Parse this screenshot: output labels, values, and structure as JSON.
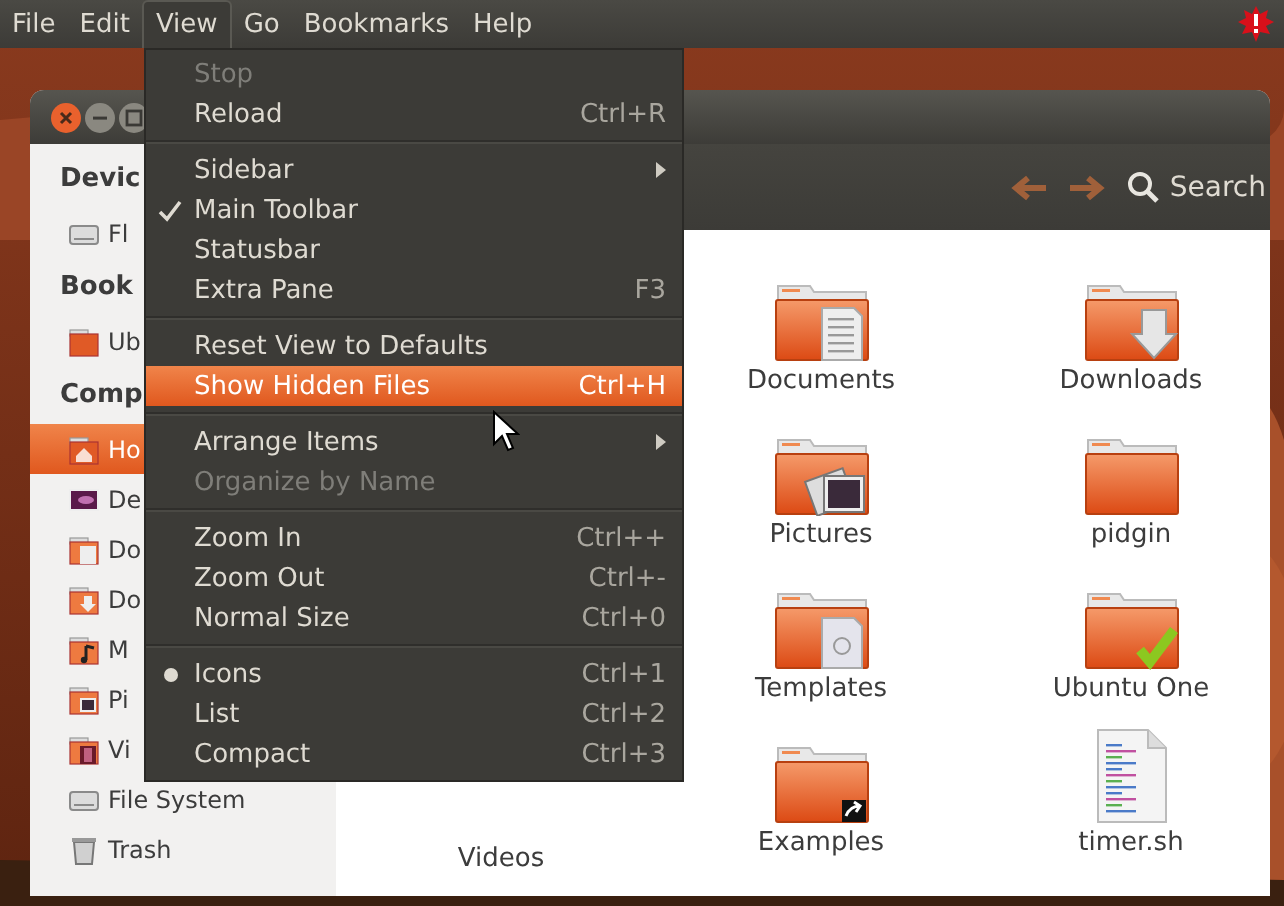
{
  "menubar": {
    "menus": [
      {
        "label": "File",
        "selected": false
      },
      {
        "label": "Edit",
        "selected": false
      },
      {
        "label": "View",
        "selected": true
      },
      {
        "label": "Go",
        "selected": false
      },
      {
        "label": "Bookmarks",
        "selected": false
      },
      {
        "label": "Help",
        "selected": false
      }
    ]
  },
  "sidebar": {
    "sections": [
      {
        "header": "Devic",
        "items": [
          {
            "label": "Fl",
            "kind": "drive",
            "selected": false
          }
        ]
      },
      {
        "header": "Book",
        "items": [
          {
            "label": "Ub",
            "kind": "folder",
            "selected": false
          }
        ]
      },
      {
        "header": "Comp",
        "items": [
          {
            "label": "Ho",
            "kind": "home",
            "selected": true
          },
          {
            "label": "De",
            "kind": "desktop",
            "selected": false
          },
          {
            "label": "Do",
            "kind": "documents",
            "selected": false
          },
          {
            "label": "Do",
            "kind": "downloads",
            "selected": false
          },
          {
            "label": "M",
            "kind": "music",
            "selected": false
          },
          {
            "label": "Pi",
            "kind": "pictures",
            "selected": false
          },
          {
            "label": "Vi",
            "kind": "videos",
            "selected": false
          },
          {
            "label": "File System",
            "kind": "filesystem",
            "selected": false
          },
          {
            "label": "Trash",
            "kind": "trash",
            "selected": false
          }
        ]
      }
    ]
  },
  "toolbar": {
    "search": "Search"
  },
  "files": [
    {
      "name": "Documents",
      "kind": "documents"
    },
    {
      "name": "Downloads",
      "kind": "downloads"
    },
    {
      "name": "Pictures",
      "kind": "pictures"
    },
    {
      "name": "pidgin",
      "kind": "folder"
    },
    {
      "name": "Templates",
      "kind": "templates"
    },
    {
      "name": "Ubuntu One",
      "kind": "sync"
    },
    {
      "name": "Videos",
      "kind": "covered"
    },
    {
      "name": "Examples",
      "kind": "link"
    },
    {
      "name": "timer.sh",
      "kind": "script"
    }
  ],
  "view_menu": {
    "items": [
      {
        "kind": "item",
        "label": "Stop",
        "disabled": true,
        "selected": false
      },
      {
        "kind": "item",
        "label": "Reload",
        "shortcut": "Ctrl+R",
        "disabled": false,
        "selected": false
      },
      {
        "kind": "separator"
      },
      {
        "kind": "item",
        "label": "Sidebar",
        "submenu": true,
        "disabled": false,
        "selected": false
      },
      {
        "kind": "check",
        "label": "Main Toolbar",
        "checked": true,
        "disabled": false,
        "selected": false
      },
      {
        "kind": "check",
        "label": "Statusbar",
        "checked": false,
        "disabled": false,
        "selected": false
      },
      {
        "kind": "check",
        "label": "Extra Pane",
        "shortcut": "F3",
        "checked": false,
        "disabled": false,
        "selected": false
      },
      {
        "kind": "separator"
      },
      {
        "kind": "item",
        "label": "Reset View to Defaults",
        "disabled": false,
        "selected": false
      },
      {
        "kind": "item",
        "label": "Show Hidden Files",
        "shortcut": "Ctrl+H",
        "disabled": false,
        "selected": true
      },
      {
        "kind": "separator"
      },
      {
        "kind": "item",
        "label": "Arrange Items",
        "submenu": true,
        "disabled": false,
        "selected": false
      },
      {
        "kind": "item",
        "label": "Organize by Name",
        "disabled": true,
        "selected": false
      },
      {
        "kind": "separator"
      },
      {
        "kind": "item",
        "label": "Zoom In",
        "shortcut": "Ctrl++",
        "disabled": false,
        "selected": false
      },
      {
        "kind": "item",
        "label": "Zoom Out",
        "shortcut": "Ctrl+-",
        "disabled": false,
        "selected": false
      },
      {
        "kind": "item",
        "label": "Normal Size",
        "shortcut": "Ctrl+0",
        "disabled": false,
        "selected": false
      },
      {
        "kind": "separator"
      },
      {
        "kind": "radio",
        "label": "Icons",
        "shortcut": "Ctrl+1",
        "checked": true,
        "disabled": false,
        "selected": false
      },
      {
        "kind": "radio",
        "label": "List",
        "shortcut": "Ctrl+2",
        "checked": false,
        "disabled": false,
        "selected": false
      },
      {
        "kind": "radio",
        "label": "Compact",
        "shortcut": "Ctrl+3",
        "checked": false,
        "disabled": false,
        "selected": false
      }
    ]
  }
}
